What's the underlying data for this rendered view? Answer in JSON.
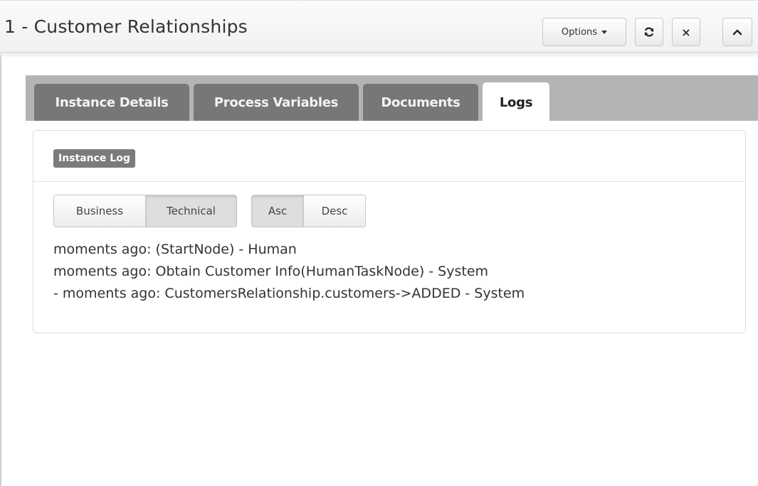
{
  "header": {
    "title": "1 - Customer Relationships",
    "options_label": "Options",
    "close_glyph": "×",
    "icons": [
      "refresh-icon",
      "close-icon",
      "chevron-up-icon",
      "caret-down-icon"
    ]
  },
  "tabs": [
    {
      "label": "Instance Details",
      "active": false
    },
    {
      "label": "Process Variables",
      "active": false
    },
    {
      "label": "Documents",
      "active": false
    },
    {
      "label": "Logs",
      "active": true
    }
  ],
  "panel": {
    "badge": "Instance Log",
    "type_toggle": {
      "options": [
        "Business",
        "Technical"
      ],
      "selected": "Technical"
    },
    "order_toggle": {
      "options": [
        "Asc",
        "Desc"
      ],
      "selected": "Asc"
    },
    "log_lines": [
      "moments ago: (StartNode) - Human",
      "moments ago: Obtain Customer Info(HumanTaskNode) - System",
      "- moments ago: CustomersRelationship.customers->ADDED - System"
    ]
  },
  "colors": {
    "tab_inactive": "#777777",
    "tab_bar": "#b4b4b4",
    "badge": "#7b7b7b"
  }
}
